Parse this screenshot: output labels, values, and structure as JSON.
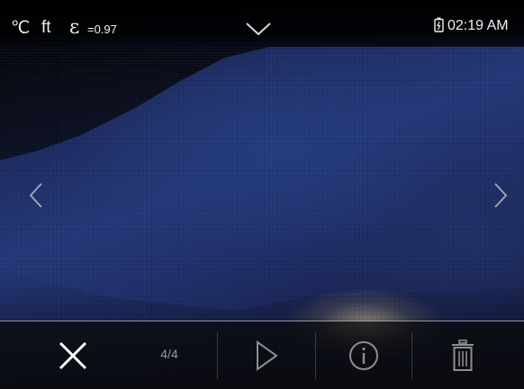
{
  "status_bar": {
    "temperature_unit": "℃",
    "distance_unit": "ft",
    "emissivity_symbol": "ε",
    "emissivity_value": "=0.97",
    "time": "02:19 AM",
    "dropdown_icon": "chevron-down-icon",
    "battery_icon": "battery-icon"
  },
  "navigation": {
    "previous_icon": "chevron-left-icon",
    "next_icon": "chevron-right-icon"
  },
  "toolbar": {
    "close_icon": "close-icon",
    "counter": "4/4",
    "play_icon": "play-icon",
    "info_icon": "info-icon",
    "delete_icon": "trash-icon"
  },
  "colors": {
    "text": "#ededed",
    "counter_text": "#9a9a9a",
    "image_blue": "#233776",
    "bar_background": "#0a0a0a"
  }
}
